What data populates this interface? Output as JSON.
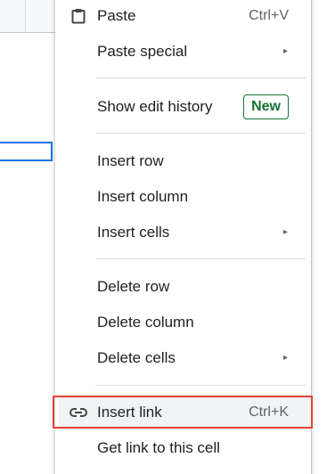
{
  "context_menu": {
    "items": [
      {
        "label": "Paste",
        "shortcut": "Ctrl+V",
        "icon": "clipboard-icon"
      },
      {
        "label": "Paste special",
        "submenu": "▸"
      },
      {
        "label": "Show edit history",
        "badge": "New"
      },
      {
        "label": "Insert row"
      },
      {
        "label": "Insert column"
      },
      {
        "label": "Insert cells",
        "submenu": "▸"
      },
      {
        "label": "Delete row"
      },
      {
        "label": "Delete column"
      },
      {
        "label": "Delete cells",
        "submenu": "▸"
      },
      {
        "label": "Insert link",
        "shortcut": "Ctrl+K",
        "icon": "link-icon",
        "highlighted": true
      },
      {
        "label": "Get link to this cell"
      }
    ]
  },
  "colors": {
    "selection_blue": "#1a73e8",
    "highlight_red": "#ea4335",
    "badge_green": "#137333",
    "hover_gray": "#f1f3f4"
  }
}
